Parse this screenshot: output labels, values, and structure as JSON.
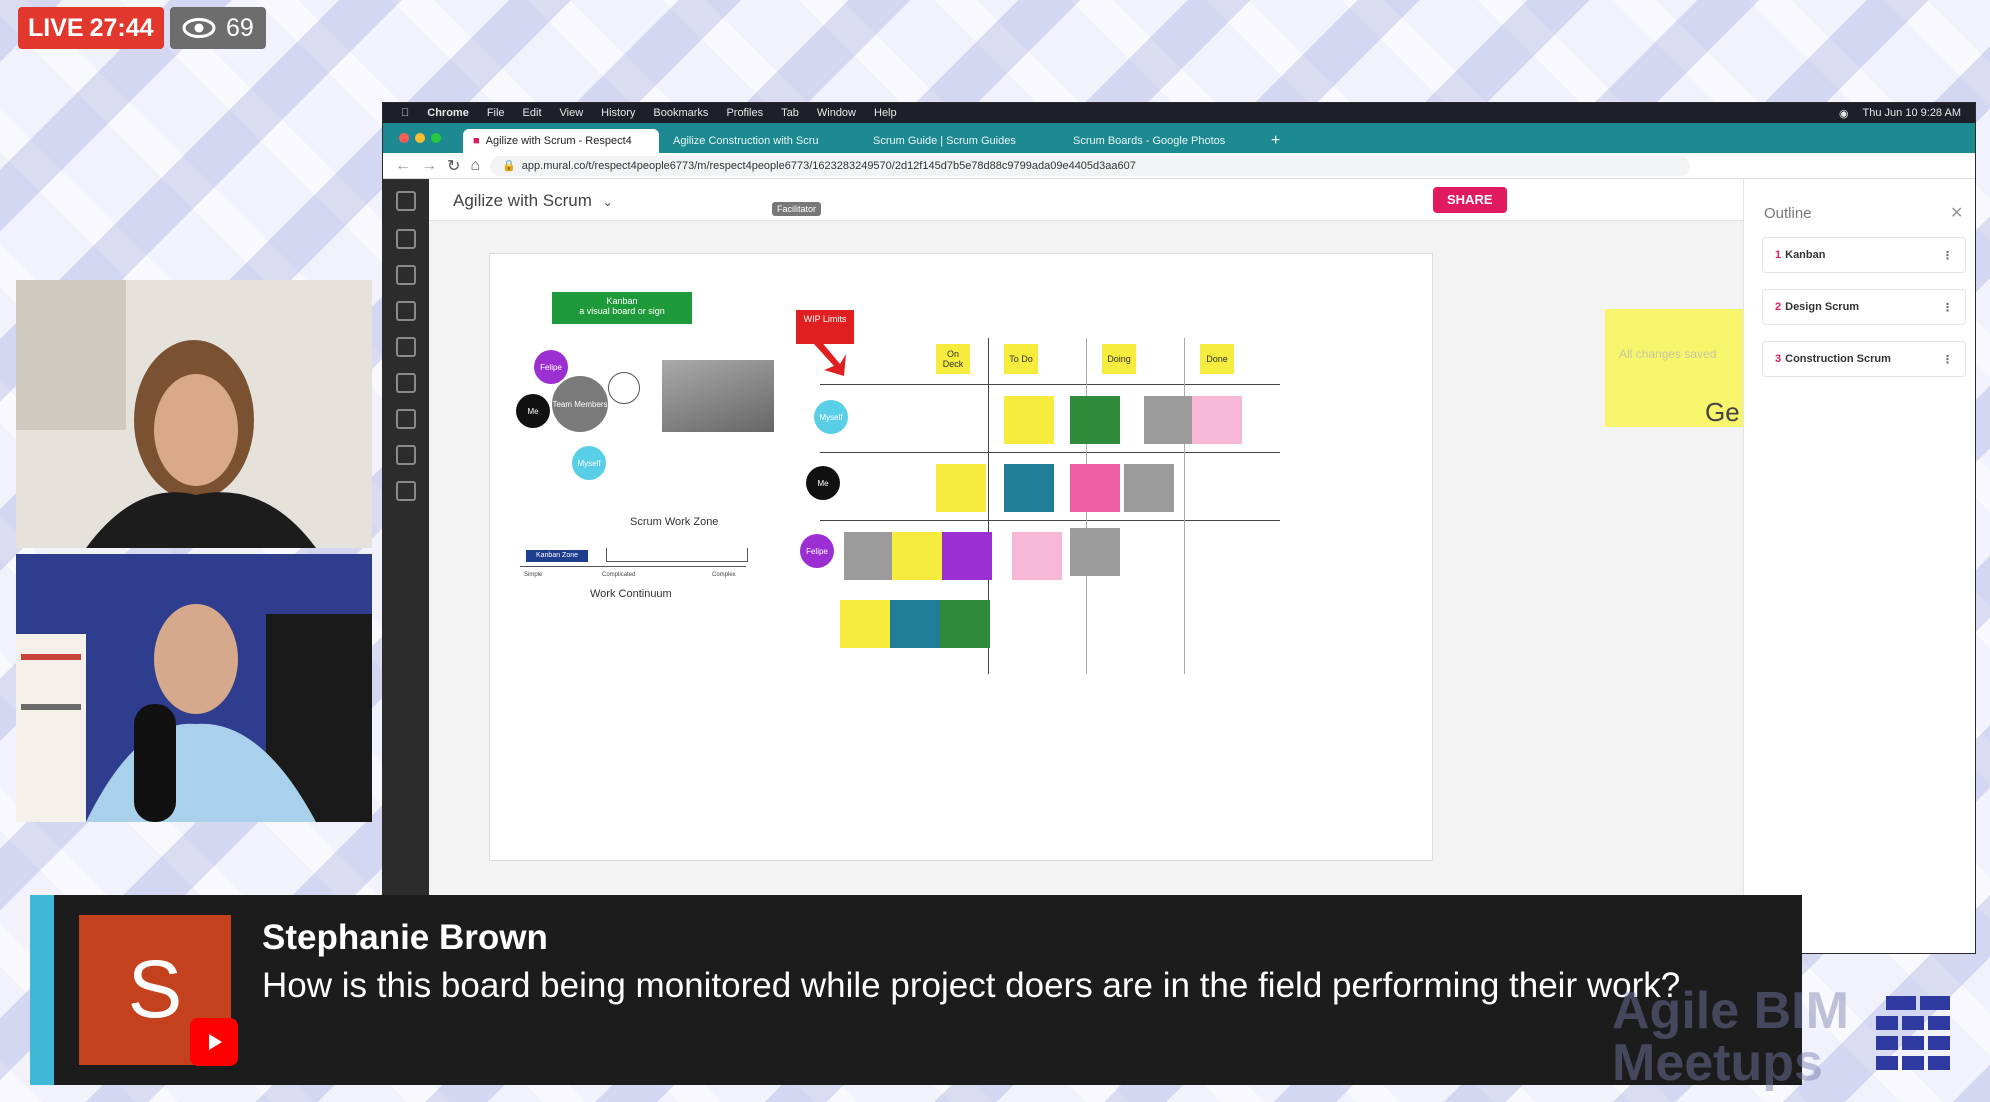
{
  "live": {
    "label": "LIVE",
    "time": "27:44",
    "viewers": "69"
  },
  "webcams": [
    {
      "name": "webcam-host-1"
    },
    {
      "name": "webcam-host-2"
    }
  ],
  "mac_menubar": {
    "items": [
      "Chrome",
      "File",
      "Edit",
      "View",
      "History",
      "Bookmarks",
      "Profiles",
      "Tab",
      "Window",
      "Help"
    ],
    "clock": "Thu Jun 10 9:28 AM"
  },
  "browser": {
    "tabs": [
      {
        "label": "Agilize with Scrum - Respect4"
      },
      {
        "label": "Agilize Construction with Scru"
      },
      {
        "label": "Scrum Guide | Scrum Guides"
      },
      {
        "label": "Scrum Boards - Google Photos"
      }
    ],
    "url": "app.mural.co/t/respect4people6773/m/respect4people6773/1623283249570/2d12f145d7b5e78d88c9799ada09e4405d3aa607"
  },
  "mural": {
    "board_title": "Agilize with Scrum",
    "facilitator": "Facilitator",
    "share": "SHARE",
    "saved": "All changes saved",
    "note_big": "Ge",
    "outline_title": "Outline",
    "outline_items": [
      {
        "num": "1",
        "label": "Kanban"
      },
      {
        "num": "2",
        "label": "Design Scrum"
      },
      {
        "num": "3",
        "label": "Construction Scrum"
      }
    ],
    "kanban_label": "Kanban\na visual board or sign",
    "wip_label": "WIP Limits",
    "columns": [
      "On Deck",
      "To Do",
      "Doing",
      "Done"
    ],
    "rows": [
      "Myself",
      "Me",
      "Felipe"
    ],
    "scrum_work_zone": "Scrum Work Zone",
    "kanban_zone": "Kanban Zone",
    "work_continuum": "Work Continuum",
    "continuum_ticks": [
      "Simple",
      "Complicated",
      "Complex"
    ],
    "team_members": "Team Members"
  },
  "lower_third": {
    "initial": "S",
    "commenter": "Stephanie Brown",
    "comment": "How is this board being monitored while project doers are in the field performing their work?"
  },
  "brand": {
    "line1": "Agile BIM",
    "line2": "Meetups"
  },
  "colors": {
    "live": "#e2372c",
    "share": "#e1195f",
    "accent": "#3fb7d6",
    "avatar": "#c3411d"
  }
}
